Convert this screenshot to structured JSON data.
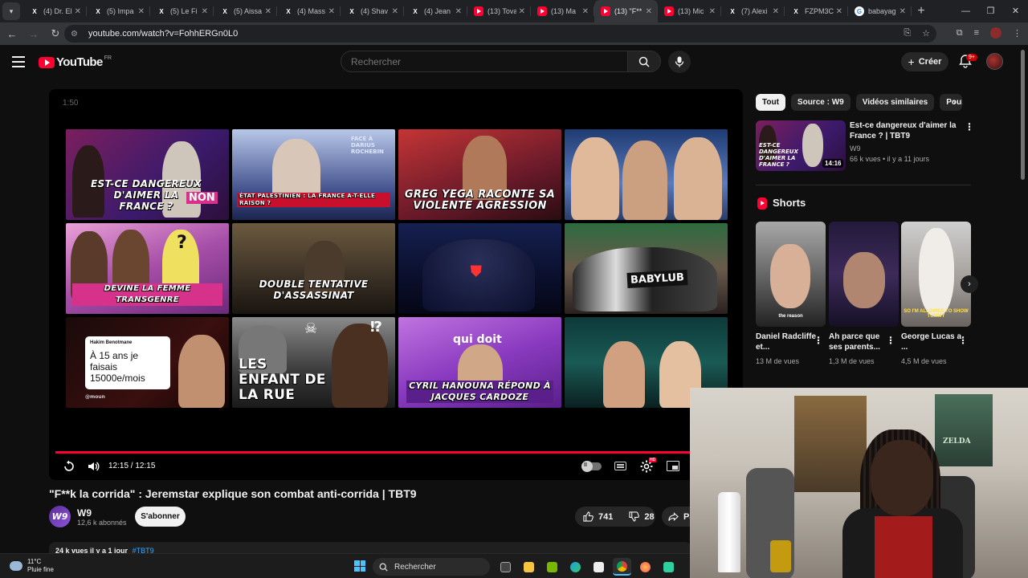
{
  "browser": {
    "tabs": [
      {
        "label": "(4) Dr. El",
        "icon": "x-icon"
      },
      {
        "label": "(5) Impa",
        "icon": "x-icon"
      },
      {
        "label": "(5) Le Fi",
        "icon": "x-icon"
      },
      {
        "label": "(5) Aissa",
        "icon": "x-icon"
      },
      {
        "label": "(4) Mass",
        "icon": "x-icon"
      },
      {
        "label": "(4) Shav",
        "icon": "x-icon"
      },
      {
        "label": "(4) Jean",
        "icon": "x-icon"
      },
      {
        "label": "(13) Tova",
        "icon": "youtube-icon"
      },
      {
        "label": "(13) Ma",
        "icon": "youtube-icon"
      },
      {
        "label": "(13) \"F**",
        "icon": "youtube-icon",
        "active": true
      },
      {
        "label": "(13) Mic",
        "icon": "youtube-icon"
      },
      {
        "label": "(7) Alexi",
        "icon": "x-icon"
      },
      {
        "label": "FZPM3C",
        "icon": "x-icon"
      },
      {
        "label": "babayag",
        "icon": "google-icon"
      }
    ],
    "url": "youtube.com/watch?v=FohhERGn0L0"
  },
  "youtube": {
    "logo_text": "YouTube",
    "country": "FR",
    "search_placeholder": "Rechercher",
    "create_label": "Créer",
    "notif_count": "9+"
  },
  "player": {
    "end_time_label": "1:50",
    "time_display": "12:15 / 12:15",
    "progress": 1.0,
    "hd_badge": "HD",
    "endscreen": [
      {
        "caption": "EST-CE DANGEREUX D'AIMER LA FRANCE ?",
        "side": "NON"
      },
      {
        "caption": "ÉTAT PALESTINIEN : LA FRANCE A-T-ELLE RAISON ?",
        "side": "FACE À DARIUS ROCHEBIN"
      },
      {
        "caption": "GREG YEGA RACONTE SA VIOLENTE AGRESSION",
        "side": ""
      },
      {
        "caption": "",
        "side": ""
      },
      {
        "caption": "DEVINE LA FEMME TRANSGENRE",
        "side": ""
      },
      {
        "caption": "DOUBLE TENTATIVE D'ASSASSINAT",
        "side": ""
      },
      {
        "caption": "",
        "side": ""
      },
      {
        "caption": "",
        "side": "BABYLUB"
      },
      {
        "caption": "",
        "side": "Hakim Benotmane",
        "tweet": "À 15 ans je faisais 15000e/mois",
        "handle": "@moun"
      },
      {
        "caption": "LES ENFANT DE LA RUE",
        "side": ""
      },
      {
        "caption": "CYRIL HANOUNA RÉPOND À JACQUES CARDOZE",
        "side": "qui doit"
      },
      {
        "caption": "",
        "side": ""
      }
    ]
  },
  "video": {
    "title": "\"F**k la corrida\" : Jeremstar explique son combat anti-corrida | TBT9",
    "channel_initials": "W9",
    "channel_name": "W9",
    "subscribers": "12,6 k abonnés",
    "subscribe_label": "S'abonner",
    "likes": "741",
    "dislikes": "28",
    "share_label": "Pa",
    "views_line": "24 k vues  il y a 1 jour",
    "hashtag": "#TBT9"
  },
  "sidebar": {
    "chips": [
      "Tout",
      "Source : W9",
      "Vidéos similaires",
      "Pour"
    ],
    "recommended": {
      "title": "Est-ce dangereux d'aimer la France ? | TBT9",
      "channel": "W9",
      "meta": "66 k vues • il y a 11 jours",
      "duration": "14:16",
      "thumb_caption": "EST-CE DANGEREUX D'AIMER LA FRANCE ?"
    },
    "shorts_label": "Shorts",
    "shorts": [
      {
        "title": "Daniel Radcliffe et...",
        "views": "13 M de vues",
        "overlay": "the reason"
      },
      {
        "title": "Ah parce que ses parents...",
        "views": "1,3 M de vues",
        "overlay": ""
      },
      {
        "title": "George Lucas a ...",
        "views": "4,5 M de vues",
        "overlay": "SO I'M ALLOWED TO SHOW TUMMY"
      }
    ]
  },
  "webcam": {
    "poster_text": "ZELDA"
  },
  "taskbar": {
    "temperature": "11°C",
    "weather": "Pluie fine",
    "search_label": "Rechercher"
  }
}
